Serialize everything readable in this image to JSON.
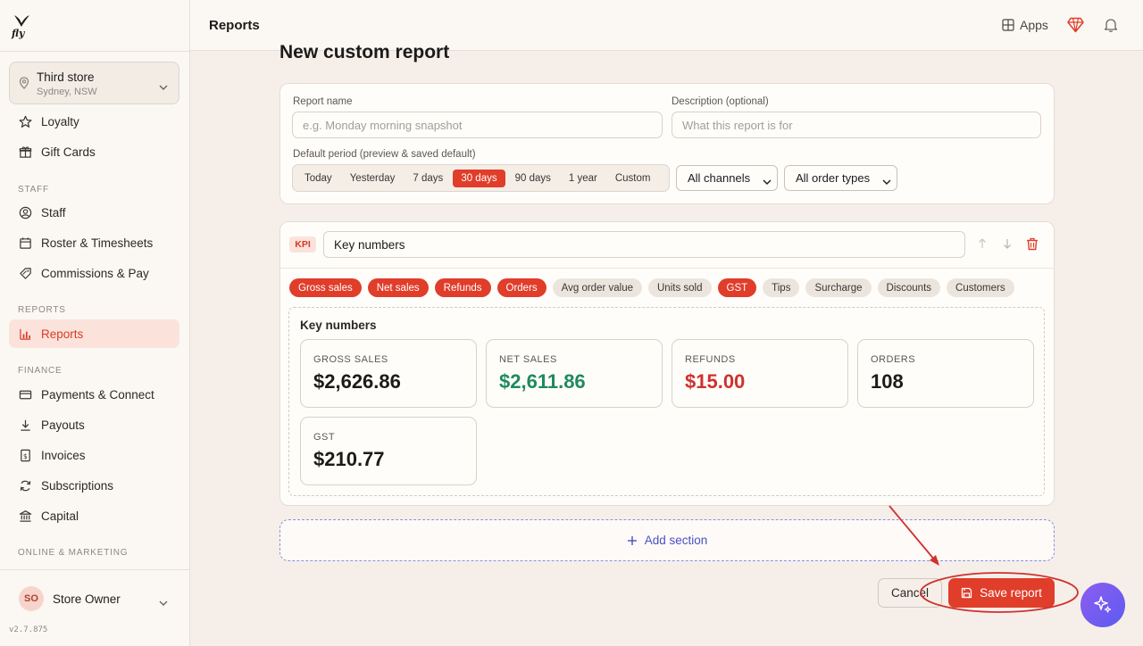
{
  "app": {
    "logo_text": "fly",
    "header_title": "Reports",
    "apps_label": "Apps",
    "version": "v2.7.875"
  },
  "store": {
    "name": "Third store",
    "location": "Sydney, NSW"
  },
  "sidebar": {
    "top_items": [
      {
        "label": "Loyalty",
        "icon": "star-icon"
      },
      {
        "label": "Gift Cards",
        "icon": "gift-icon"
      }
    ],
    "sections": [
      {
        "label": "STAFF",
        "items": [
          {
            "label": "Staff"
          },
          {
            "label": "Roster & Timesheets"
          },
          {
            "label": "Commissions & Pay"
          }
        ]
      },
      {
        "label": "REPORTS",
        "items": [
          {
            "label": "Reports",
            "active": true
          }
        ]
      },
      {
        "label": "FINANCE",
        "items": [
          {
            "label": "Payments & Connect"
          },
          {
            "label": "Payouts"
          },
          {
            "label": "Invoices"
          },
          {
            "label": "Subscriptions"
          },
          {
            "label": "Capital"
          }
        ]
      },
      {
        "label": "ONLINE & MARKETING",
        "items": []
      }
    ]
  },
  "user": {
    "initials": "SO",
    "name": "Store Owner"
  },
  "page": {
    "title": "New custom report"
  },
  "form": {
    "report_name_label": "Report name",
    "report_name_placeholder": "e.g. Monday morning snapshot",
    "description_label": "Description (optional)",
    "description_placeholder": "What this report is for",
    "period_label": "Default period (preview & saved default)",
    "periods": [
      "Today",
      "Yesterday",
      "7 days",
      "30 days",
      "90 days",
      "1 year",
      "Custom"
    ],
    "selected_period": "30 days",
    "channel_select": "All channels",
    "order_type_select": "All order types"
  },
  "section": {
    "tag": "KPI",
    "name": "Key numbers",
    "metrics": [
      {
        "label": "Gross sales",
        "on": true
      },
      {
        "label": "Net sales",
        "on": true
      },
      {
        "label": "Refunds",
        "on": true
      },
      {
        "label": "Orders",
        "on": true
      },
      {
        "label": "Avg order value",
        "on": false
      },
      {
        "label": "Units sold",
        "on": false
      },
      {
        "label": "GST",
        "on": true
      },
      {
        "label": "Tips",
        "on": false
      },
      {
        "label": "Surcharge",
        "on": false
      },
      {
        "label": "Discounts",
        "on": false
      },
      {
        "label": "Customers",
        "on": false
      }
    ],
    "preview_title": "Key numbers",
    "kpis": [
      {
        "label": "GROSS SALES",
        "value": "$2,626.86",
        "color": "#1d1b1a"
      },
      {
        "label": "NET SALES",
        "value": "$2,611.86",
        "color": "#1f8a5c"
      },
      {
        "label": "REFUNDS",
        "value": "$15.00",
        "color": "#d0312d"
      },
      {
        "label": "ORDERS",
        "value": "108",
        "color": "#1d1b1a"
      },
      {
        "label": "GST",
        "value": "$210.77",
        "color": "#1d1b1a"
      }
    ]
  },
  "actions": {
    "add_section": "Add section",
    "cancel": "Cancel",
    "save": "Save report"
  },
  "colors": {
    "accent": "#e03d2a",
    "link": "#4a50c4",
    "annotation": "#d0312d"
  }
}
